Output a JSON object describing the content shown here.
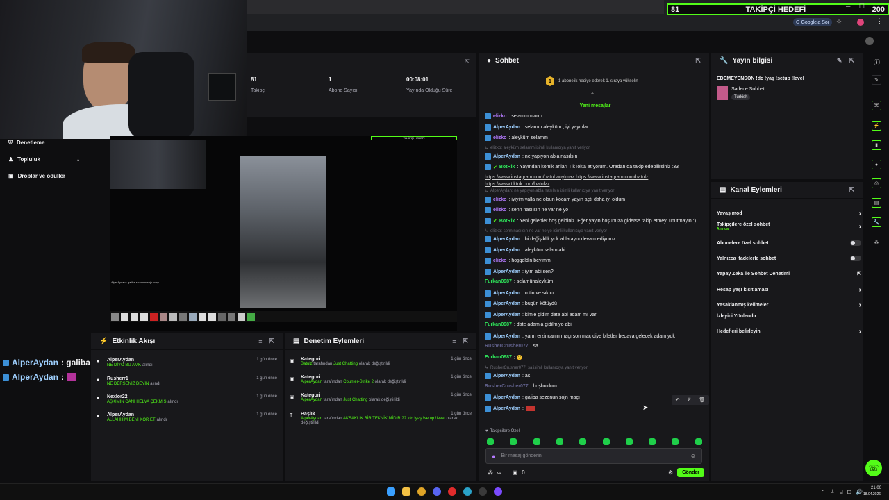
{
  "topbar": {
    "goal_count": "81",
    "goal_title": "TAKİPÇİ HEDEFİ",
    "goal_target": "200",
    "google_btn": "Google'a Sor"
  },
  "stats": {
    "followers_value": "81",
    "followers_label": "Takipçi",
    "subs_value": "1",
    "subs_label": "Abone Sayısı",
    "uptime_value": "00:08:01",
    "uptime_label": "Yayında Olduğu Süre"
  },
  "leftnav": {
    "items": [
      "Denetleme",
      "Topluluk",
      "Droplar ve ödüller"
    ]
  },
  "preview": {
    "overlay_goal": "TAKİPÇİ HEDEFİ",
    "overlay_chat": "AlperAydan : galiba sezonun sojn maçı"
  },
  "stream_chat_overlay": {
    "line1_user": "AlperAydan",
    "line1_text": ": galiba sezonun sojn maçı",
    "line2_user": "AlperAydan",
    "line2_text": ":"
  },
  "activity": {
    "title": "Etkinlik Akışı",
    "items": [
      {
        "name": "AlperAydan",
        "sub": "NE DİYO BU AMK",
        "extra": "alındı",
        "time": "1 gün önce"
      },
      {
        "name": "Rusherr1",
        "sub": "NE DERSENİZ DEYİN",
        "extra": "alındı",
        "time": "1 gün önce"
      },
      {
        "name": "Nexlor22",
        "sub": "AŞKIMIN CANI HELVA ÇEKMİŞ",
        "extra": "alındı",
        "time": "1 gün önce"
      },
      {
        "name": "AlperAydan",
        "sub": "ALLAHHIM BENİ KÖR ET",
        "extra": "alındı",
        "time": "1 gün önce"
      }
    ]
  },
  "moderation": {
    "title": "Denetim Eylemleri",
    "items": [
      {
        "name": "Kategori",
        "user": "Batulz",
        "mid": "tarafından",
        "val": "Just Chatting",
        "end": "olarak değiştirildi",
        "time": "1 gün önce"
      },
      {
        "name": "Kategori",
        "user": "AlperAydan",
        "mid": "tarafından",
        "val": "Counter-Strike 2",
        "end": "olarak değiştirildi",
        "time": "1 gün önce"
      },
      {
        "name": "Kategori",
        "user": "AlperAydan",
        "mid": "tarafından",
        "val": "Just Chatting",
        "end": "olarak değiştirildi",
        "time": "1 gün önce"
      },
      {
        "name": "Başlık",
        "user": "AlperAydan",
        "mid": "tarafından",
        "val": "AKSAKLIK BİR TEKNİK MİDİR ?? !dc !yaş !setup !level",
        "end": "olarak değiştirildi",
        "time": "1 gün önce"
      }
    ]
  },
  "chat": {
    "title": "Sohbet",
    "sub_promo": "1 abonelik hediye ederek 1. sıraya yükselin",
    "new_messages": "Yeni mesajlar",
    "messages": [
      {
        "user": "elizko",
        "color": "purple",
        "text": ": selammmlarrrr"
      },
      {
        "user": "AlperAydan",
        "color": "blue",
        "text": ": selamın aleyküm , iyi yayınlar"
      },
      {
        "user": "elizko",
        "color": "purple",
        "text": ": aleyküm selamm"
      },
      {
        "reply": "elizko: aleyküm selamm isimli kullanıcıya yanıt veriyor"
      },
      {
        "user": "AlperAydan",
        "color": "blue",
        "text": ": ne yapıyon abla nasılsın"
      },
      {
        "user": "BotRix",
        "color": "green",
        "text": ": Yayından komik anları TikTok'a atıyorum. Oradan da takip edebilirsiniz :33"
      },
      {
        "link": "https://www.instagram.com/batuhanylmaz https://www.instagram.com/batulz"
      },
      {
        "link": "https://www.tiktok.com/batulzz"
      },
      {
        "reply": "AlperAydan: ne yapıyon abla nasılsın isimli kullanıcıya yanıt veriyor"
      },
      {
        "user": "elizko",
        "color": "purple",
        "text": ": iyiyim valla ne olsun kocam yayın açtı daha iyi oldum"
      },
      {
        "user": "elizko",
        "color": "purple",
        "text": ": senn nasılsın ne var ne yo"
      },
      {
        "user": "BotRix",
        "color": "green",
        "text": ": Yeni gelenler hoş geldiniz. Eğer yayın hoşunuza giderse takip etmeyi unutmayın :)"
      },
      {
        "reply": "elizko: senn nasılsın ne var ne yo isimli kullanıcıya yanıt veriyor"
      },
      {
        "user": "AlperAydan",
        "color": "blue",
        "text": ": bi değişiklik yok abla aynı devam ediyoruz"
      },
      {
        "user": "AlperAydan",
        "color": "blue",
        "text": ": aleyküm selam abi"
      },
      {
        "user": "elizko",
        "color": "purple",
        "text": ": hoşgeldin beyimm"
      },
      {
        "user": "AlperAydan",
        "color": "blue",
        "text": ": iyim abi sen?"
      },
      {
        "user": "Furkan0987",
        "color": "green",
        "text": ": selamünaleyküm"
      },
      {
        "user": "AlperAydan",
        "color": "blue",
        "text": ": rutin ve sıkıcı"
      },
      {
        "user": "AlperAydan",
        "color": "blue",
        "text": ": bugün kötüydü"
      },
      {
        "user": "AlperAydan",
        "color": "blue",
        "text": ": kimle gidim date abi adam mı var"
      },
      {
        "user": "Furkan0987",
        "color": "green",
        "text": ": date adamla gidilmiyo abi"
      },
      {
        "user": "AlperAydan",
        "color": "blue",
        "text": ": yarın erzincanın maçı son maç diye biletler bedava gelecek adam yok"
      },
      {
        "user": "RusherCrusher077",
        "color": "gray",
        "text": ": sa"
      },
      {
        "user": "Furkan0987",
        "color": "green",
        "text": ": 😊"
      },
      {
        "reply": "RusherCrusher077: sa isimli kullanıcıya yanıt veriyor"
      },
      {
        "user": "AlperAydan",
        "color": "blue",
        "text": ": as"
      },
      {
        "user": "RusherCrusher077",
        "color": "gray",
        "text": ": hoşbuldum"
      },
      {
        "user": "AlperAydan",
        "color": "blue",
        "text": ": galiba sezonun sojn maçı"
      },
      {
        "user": "AlperAydan",
        "color": "blue",
        "text": ":"
      }
    ],
    "followers_only": "Takipçilere Özel",
    "input_placeholder": "Bir mesaj gönderin",
    "points": "∞",
    "gift_count": "0",
    "send": "Gönder"
  },
  "stream_info": {
    "title": "Yayın bilgisi",
    "stream_title": "EDEMEYENSON !dc !yaş !setup !level",
    "category": "Sadece Sohbet",
    "tag": "Turkish"
  },
  "channel_actions": {
    "title": "Kanal Eylemleri",
    "items": [
      {
        "label": "Yavaş mod",
        "kind": "arrow"
      },
      {
        "label": "Takipçilere özel sohbet",
        "sub": "Anında",
        "kind": "arrow"
      },
      {
        "label": "Abonelere özel sohbet",
        "kind": "toggle"
      },
      {
        "label": "Yalnızca ifadelerle sohbet",
        "kind": "toggle"
      },
      {
        "label": "Yapay Zeka ile Sohbet Denetimi",
        "kind": "ext"
      },
      {
        "label": "Hesap yaşı kısıtlaması",
        "kind": "arrow"
      },
      {
        "label": "Yasaklanmış kelimeler",
        "kind": "arrow"
      },
      {
        "label": "İzleyici Yönlendir",
        "kind": "none"
      },
      {
        "label": "Hedefleri belirleyin",
        "kind": "arrow"
      }
    ]
  },
  "taskbar": {
    "time": "21:00",
    "date": "18.04.2026"
  },
  "colors": {
    "accent": "#53fc18",
    "blue_user": "#9fd0ff",
    "purple_user": "#b57bff"
  }
}
